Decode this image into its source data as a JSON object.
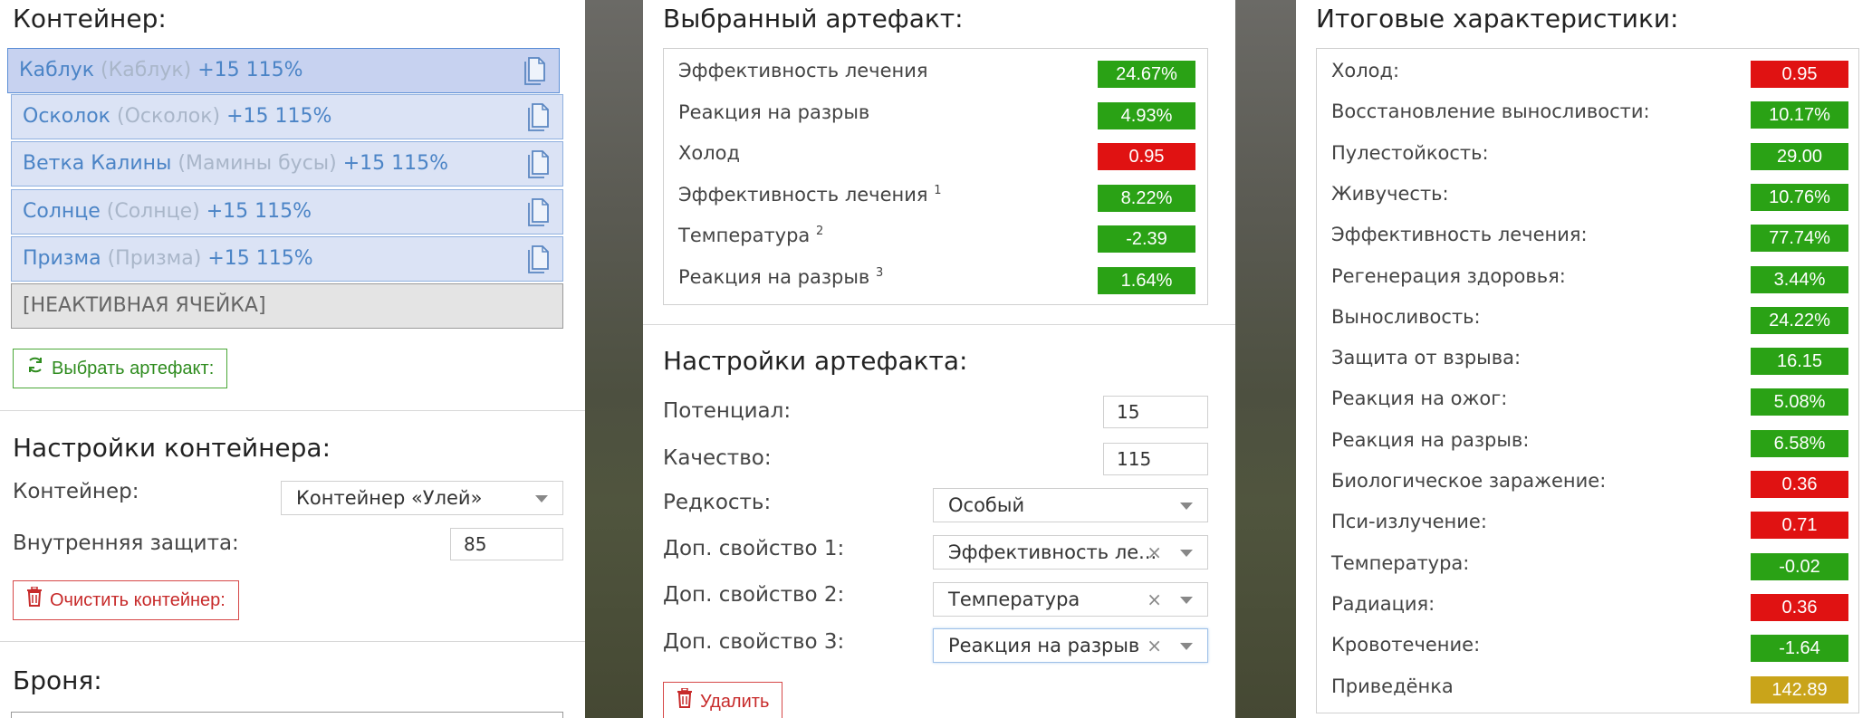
{
  "left": {
    "container_title": "Контейнер:",
    "slots": [
      {
        "name": "Каблук",
        "alias": "(Каблук)",
        "level": "+15 115%"
      },
      {
        "name": "Осколок",
        "alias": "(Осколок)",
        "level": "+15 115%"
      },
      {
        "name": "Ветка Калины",
        "alias": "(Мамины бусы)",
        "level": "+15 115%"
      },
      {
        "name": "Солнце",
        "alias": "(Солнце)",
        "level": "+15 115%"
      },
      {
        "name": "Призма",
        "alias": "(Призма)",
        "level": "+15 115%"
      }
    ],
    "inactive_slot": "[НЕАКТИВНАЯ ЯЧЕЙКА]",
    "choose_button": "Выбрать артефакт:",
    "settings_title": "Настройки контейнера:",
    "container_label": "Контейнер:",
    "container_value": "Контейнер «Улей»",
    "inner_protection_label": "Внутренняя защита:",
    "inner_protection_value": "85",
    "clear_button": "Очистить контейнер:",
    "armor_title": "Броня:"
  },
  "middle": {
    "selected_title": "Выбранный артефакт:",
    "stats": [
      {
        "label": "Эффективность лечения",
        "sup": "",
        "value": "24.67%",
        "color": "green"
      },
      {
        "label": "Реакция на разрыв",
        "sup": "",
        "value": "4.93%",
        "color": "green"
      },
      {
        "label": "Холод",
        "sup": "",
        "value": "0.95",
        "color": "red"
      },
      {
        "label": "Эффективность лечения",
        "sup": "1",
        "value": "8.22%",
        "color": "green"
      },
      {
        "label": "Температура",
        "sup": "2",
        "value": "-2.39",
        "color": "green"
      },
      {
        "label": "Реакция на разрыв",
        "sup": "3",
        "value": "1.64%",
        "color": "green"
      }
    ],
    "settings_title": "Настройки артефакта:",
    "potential_label": "Потенциал:",
    "potential_value": "15",
    "quality_label": "Качество:",
    "quality_value": "115",
    "rarity_label": "Редкость:",
    "rarity_value": "Особый",
    "extra1_label": "Доп. свойство 1:",
    "extra1_value": "Эффективность ле...",
    "extra2_label": "Доп. свойство 2:",
    "extra2_value": "Температура",
    "extra3_label": "Доп. свойство 3:",
    "extra3_value": "Реакция на разрыв",
    "clear_symbol": "×",
    "delete_button": "Удалить"
  },
  "right": {
    "title": "Итоговые характеристики:",
    "stats": [
      {
        "label": "Холод:",
        "value": "0.95",
        "color": "red"
      },
      {
        "label": "Восстановление выносливости:",
        "value": "10.17%",
        "color": "green"
      },
      {
        "label": "Пулестойкость:",
        "value": "29.00",
        "color": "green"
      },
      {
        "label": "Живучесть:",
        "value": "10.76%",
        "color": "green"
      },
      {
        "label": "Эффективность лечения:",
        "value": "77.74%",
        "color": "green"
      },
      {
        "label": "Регенерация здоровья:",
        "value": "3.44%",
        "color": "green"
      },
      {
        "label": "Выносливость:",
        "value": "24.22%",
        "color": "green"
      },
      {
        "label": "Защита от взрыва:",
        "value": "16.15",
        "color": "green"
      },
      {
        "label": "Реакция на ожог:",
        "value": "5.08%",
        "color": "green"
      },
      {
        "label": "Реакция на разрыв:",
        "value": "6.58%",
        "color": "green"
      },
      {
        "label": "Биологическое заражение:",
        "value": "0.36",
        "color": "red"
      },
      {
        "label": "Пси-излучение:",
        "value": "0.71",
        "color": "red"
      },
      {
        "label": "Температура:",
        "value": "-0.02",
        "color": "green"
      },
      {
        "label": "Радиация:",
        "value": "0.36",
        "color": "red"
      },
      {
        "label": "Кровотечение:",
        "value": "-1.64",
        "color": "green"
      },
      {
        "label": "Приведёнка",
        "value": "142.89",
        "color": "gold"
      }
    ]
  },
  "colors": {
    "green": "#2aa215",
    "red": "#e01212",
    "gold": "#c9a41a"
  }
}
